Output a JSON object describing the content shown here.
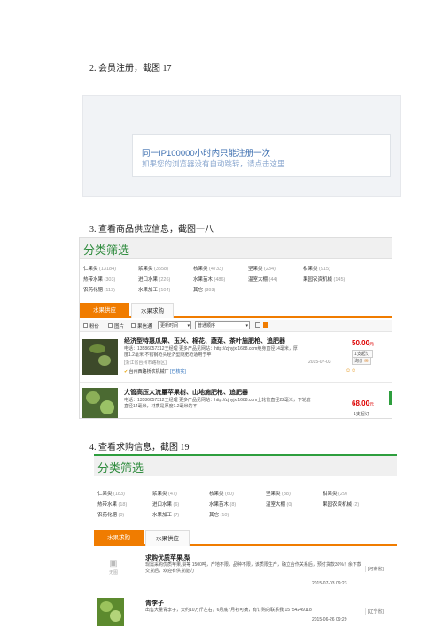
{
  "captions": {
    "c1": "2. 会员注册，截图 17",
    "c2": "3. 查看商品供应信息，截图一八",
    "c3": "4. 查看求购信息，截图 19"
  },
  "register_notice": {
    "line1": "同一IP100000小时内只能注册一次",
    "line2": "如果您的浏览器没有自动跳转，请点击这里"
  },
  "supply_page": {
    "header": "分类筛选",
    "categories": [
      [
        "仁果类",
        "(13184)"
      ],
      [
        "浆果类",
        "(3558)"
      ],
      [
        "核果类",
        "(4733)"
      ],
      [
        "坚果类",
        "(234)"
      ],
      [
        "柑果类",
        "(915)"
      ],
      [
        "热带水果",
        "(303)"
      ],
      [
        "进口水果",
        "(226)"
      ],
      [
        "水果苗木",
        "(486)"
      ],
      [
        "温室大棚",
        "(44)"
      ],
      [
        "果园农资机械",
        "(145)"
      ],
      [
        "农药化肥",
        "(113)"
      ],
      [
        "水果加工",
        "(104)"
      ],
      [
        "其它",
        "(393)"
      ]
    ],
    "tabs": [
      "水果供应",
      "水果求购"
    ],
    "toolbar": {
      "opt1": "粉价",
      "opt2": "图片",
      "opt3": "果信通",
      "sort_select": "更新时间",
      "order_select": "普通顺序"
    },
    "items": [
      {
        "title": "经济型特惠瓜果、玉米、棉花、蔬菜、茶叶施肥枪、追肥器",
        "desc": "电话：13586057312王经理 更多产品见网站：http://zjnyjx.1688.com绝身直径14毫米，厚度1.2毫米 不锈钢枪头经济型随肥枪适用于苹",
        "location": "[浙江省台州市路桥区]",
        "date": "2015-07-03",
        "company": "台州西路桥农机械厂",
        "badge": "[已核实]",
        "price": "50.00",
        "unit": "元",
        "min_order": "1支起订",
        "inquiry": "询价"
      },
      {
        "title": "大管高压大流量苹果树、山地施肥枪、追肥器",
        "desc": "电话：13586057312王经理 更多产品见网站：http://zjnyjx.1688.com上轮管直径22毫米，下轮管直径14毫米，材质是厚度1.2毫米的不",
        "price": "68.00",
        "unit": "元",
        "min_order": "1支起订"
      }
    ]
  },
  "demand_page": {
    "header": "分类筛选",
    "categories": [
      [
        "仁果类",
        "(183)"
      ],
      [
        "浆果类",
        "(47)"
      ],
      [
        "核果类",
        "(60)"
      ],
      [
        "坚果类",
        "(38)"
      ],
      [
        "柑果类",
        "(29)"
      ],
      [
        "热带水果",
        "(18)"
      ],
      [
        "进口水果",
        "(6)"
      ],
      [
        "水果苗木",
        "(8)"
      ],
      [
        "温室大棚",
        "(0)"
      ],
      [
        "果园农资机械",
        "(2)"
      ],
      [
        "农药化肥",
        "(0)"
      ],
      [
        "水果加工",
        "(7)"
      ],
      [
        "其它",
        "(10)"
      ]
    ],
    "tabs": [
      "水果求购",
      "水果供应"
    ],
    "items": [
      {
        "title": "求购优质苹果,梨",
        "desc": "现需采购优质苹果,梨等 1500吨，产地不限，品种不限，该质限生产，确立合作关系后，预付货款30%！余下款交货后，欢迎有供货能力",
        "date": "2015-07-03 09:23",
        "region": "[河南省]",
        "no_image": "无图"
      },
      {
        "title": "青李子",
        "desc": "出售大量青李子，大约10万斤左右，6月底7月初可摘，有订购的联系我 15754249118",
        "date": "2015-06-26 09:29",
        "region": "[辽宁省]"
      }
    ]
  }
}
